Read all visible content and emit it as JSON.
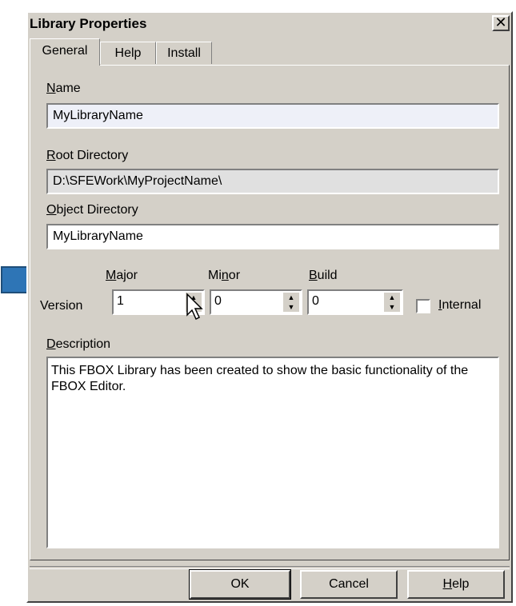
{
  "window": {
    "title": "Library Properties",
    "close_glyph": "✕"
  },
  "tabs": [
    {
      "label": "General",
      "active": true
    },
    {
      "label": "Help",
      "active": false
    },
    {
      "label": "Install",
      "active": false
    }
  ],
  "fields": {
    "name": {
      "label_key": "N",
      "label_rest": "ame",
      "value": "MyLibraryName"
    },
    "root_directory": {
      "label_key": "R",
      "label_rest": "oot Directory",
      "value": "D:\\SFEWork\\MyProjectName\\"
    },
    "object_directory": {
      "label_key": "O",
      "label_rest": "bject Directory",
      "value": "MyLibraryName"
    }
  },
  "version": {
    "label": "Version",
    "major": {
      "label_key": "M",
      "label_rest": "ajor",
      "value": "1"
    },
    "minor": {
      "label_pre": "Mi",
      "label_key": "n",
      "label_rest": "or",
      "value": "0"
    },
    "build": {
      "label_key": "B",
      "label_rest": "uild",
      "value": "0"
    },
    "internal": {
      "label_key": "I",
      "label_rest": "nternal",
      "checked": false
    }
  },
  "description": {
    "label_key": "D",
    "label_rest": "escription",
    "value": "This FBOX Library has been created to show the basic functionality of the FBOX Editor."
  },
  "buttons": {
    "ok": "OK",
    "cancel": "Cancel",
    "help_key": "H",
    "help_rest": "elp"
  },
  "colors": {
    "dialog_bg": "#d4d0c8",
    "annotation_arrow": "#2e75b6"
  },
  "icons": {
    "annotation": "blue-arrow-icon",
    "pointer": "mouse-pointer-icon",
    "spin": "spin-arrows-icon"
  }
}
